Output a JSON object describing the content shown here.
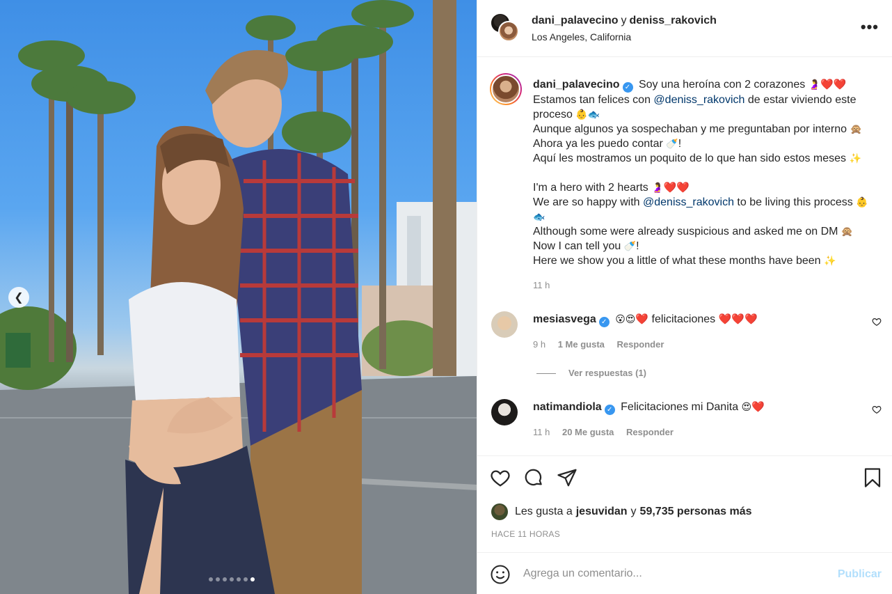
{
  "header": {
    "user1": "dani_palavecino",
    "connector": "y",
    "user2": "deniss_rakovich",
    "location": "Los Angeles, California",
    "more_label": "•••"
  },
  "caption": {
    "user": "dani_palavecino",
    "line1": "Soy una heroína con 2 corazones",
    "line2_pre": "Estamos tan felices con ",
    "line2_mention": "@deniss_rakovich",
    "line2_post": " de estar viviendo este",
    "line3": "proceso",
    "line4": "Aunque algunos ya sospechaban y me preguntaban por interno",
    "line5": "Ahora ya les puedo contar",
    "line6": "Aquí les mostramos un poquito de lo que han sido estos meses",
    "line7": "I'm a hero with 2 hearts",
    "line8_pre": "We are so happy with ",
    "line8_mention": "@deniss_rakovich",
    "line8_post": " to be living this process",
    "line9": "Although some were already suspicious and asked me on DM",
    "line10": "Now I can tell you",
    "line11": "Here we show you a little of what these months have been",
    "time": "11 h"
  },
  "comments": [
    {
      "user": "mesiasvega",
      "text": "felicitaciones",
      "time": "9 h",
      "likes": "1 Me gusta",
      "reply": "Responder",
      "view_replies": "Ver respuestas (1)"
    },
    {
      "user": "natimandiola",
      "text": "Felicitaciones mi Danita",
      "time": "11 h",
      "likes": "20 Me gusta",
      "reply": "Responder"
    }
  ],
  "likes": {
    "prefix": "Les gusta a",
    "user": "jesuvidan",
    "connector": "y",
    "count": "59,735 personas más"
  },
  "timeago": "HACE 11 HORAS",
  "add_comment": {
    "placeholder": "Agrega un comentario...",
    "publish_label": "Publicar"
  },
  "carousel": {
    "total": 7,
    "active_index": 6
  },
  "colors": {
    "accent": "#3897f0",
    "publish_disabled": "#b2dffc",
    "mention": "#00376b",
    "heart": "#e0245e"
  }
}
